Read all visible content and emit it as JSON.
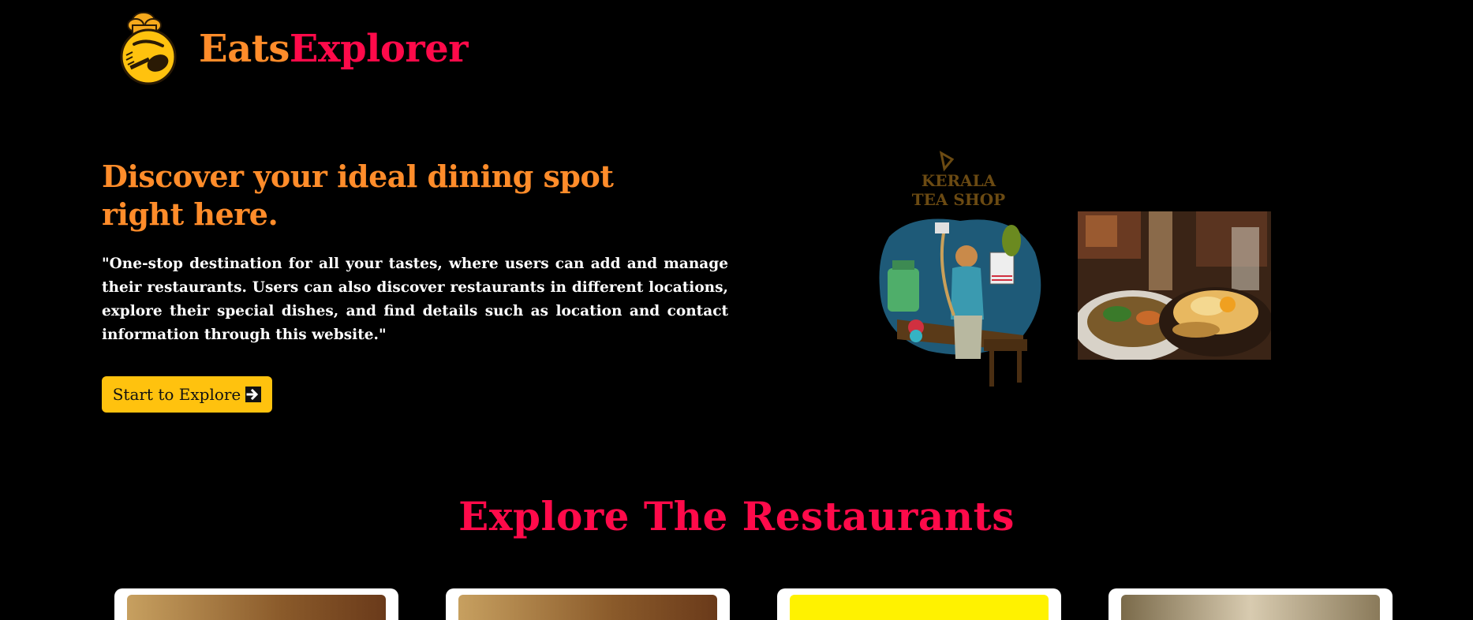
{
  "brand": {
    "name_part1": "Eats",
    "name_part2": "Explorer",
    "logo_icon": "chef-hat-face-spoon-fork-icon"
  },
  "hero": {
    "title": "Discover your ideal dining spot right here.",
    "description": "\"One-stop destination for all your tastes, where users can add and manage their restaurants. Users can also discover restaurants in different locations, explore their special dishes, and find details such as location and contact information through this website.\"",
    "cta_label": "Start to Explore",
    "cta_icon": "arrow-right-square-icon",
    "teashop_sign_line1": "KERALA",
    "teashop_sign_line2": "TEA SHOP"
  },
  "section": {
    "title": "Explore The Restaurants"
  },
  "colors": {
    "background": "#000000",
    "brand_orange": "#ff8c2a",
    "brand_pink": "#ff0a4a",
    "cta_yellow": "#ffc20e"
  }
}
